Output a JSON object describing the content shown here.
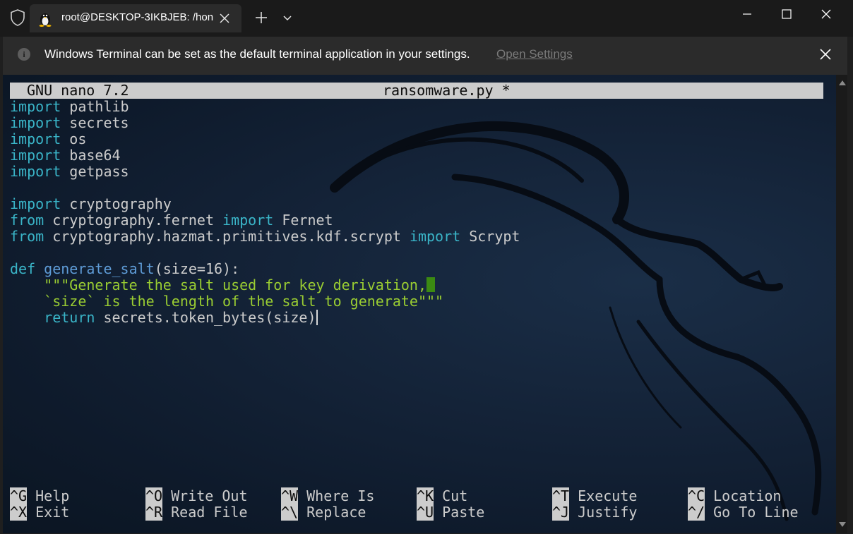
{
  "titlebar": {
    "tab_title": "root@DESKTOP-3IKBJEB: /hon",
    "icons": [
      "shield-icon",
      "linux-tux-icon",
      "close-icon",
      "plus-icon",
      "chevron-down-icon",
      "minimize-icon",
      "maximize-icon",
      "close-icon"
    ]
  },
  "infobar": {
    "message": "Windows Terminal can be set as the default terminal application in your settings.",
    "link": "Open Settings"
  },
  "nano": {
    "version": "GNU nano 7.2",
    "filename": "ransomware.py *"
  },
  "code_lines": [
    [
      {
        "t": "import",
        "c": "kw"
      },
      {
        "t": " pathlib",
        "c": ""
      }
    ],
    [
      {
        "t": "import",
        "c": "kw"
      },
      {
        "t": " secrets",
        "c": ""
      }
    ],
    [
      {
        "t": "import",
        "c": "kw"
      },
      {
        "t": " os",
        "c": ""
      }
    ],
    [
      {
        "t": "import",
        "c": "kw"
      },
      {
        "t": " base64",
        "c": ""
      }
    ],
    [
      {
        "t": "import",
        "c": "kw"
      },
      {
        "t": " getpass",
        "c": ""
      }
    ],
    [],
    [
      {
        "t": "import",
        "c": "kw"
      },
      {
        "t": " cryptography",
        "c": ""
      }
    ],
    [
      {
        "t": "from",
        "c": "kw"
      },
      {
        "t": " cryptography.fernet ",
        "c": ""
      },
      {
        "t": "import",
        "c": "kw"
      },
      {
        "t": " Fernet",
        "c": ""
      }
    ],
    [
      {
        "t": "from",
        "c": "kw"
      },
      {
        "t": " cryptography.hazmat.primitives.kdf.scrypt ",
        "c": ""
      },
      {
        "t": "import",
        "c": "kw"
      },
      {
        "t": " Scrypt",
        "c": ""
      }
    ],
    [],
    [
      {
        "t": "def",
        "c": "kw"
      },
      {
        "t": " ",
        "c": ""
      },
      {
        "t": "generate_salt",
        "c": "fn"
      },
      {
        "t": "(size=16):",
        "c": ""
      }
    ],
    [
      {
        "t": "    ",
        "c": ""
      },
      {
        "t": "\"\"\"Generate the salt used for key derivation,",
        "c": "doc"
      },
      {
        "t": "",
        "c": "cursor-block"
      }
    ],
    [
      {
        "t": "    ",
        "c": ""
      },
      {
        "t": "`size` is the length of the salt to generate\"\"\"",
        "c": "doc"
      }
    ],
    [
      {
        "t": "    ",
        "c": ""
      },
      {
        "t": "return",
        "c": "kw"
      },
      {
        "t": " secrets.token_bytes(size)",
        "c": ""
      },
      {
        "t": "",
        "c": "cursor-bar"
      }
    ]
  ],
  "shortcuts": [
    {
      "key": "^G",
      "label": "Help"
    },
    {
      "key": "^X",
      "label": "Exit"
    },
    {
      "key": "^O",
      "label": "Write Out"
    },
    {
      "key": "^R",
      "label": "Read File"
    },
    {
      "key": "^W",
      "label": "Where Is"
    },
    {
      "key": "^\\",
      "label": "Replace"
    },
    {
      "key": "^K",
      "label": "Cut"
    },
    {
      "key": "^U",
      "label": "Paste"
    },
    {
      "key": "^T",
      "label": "Execute"
    },
    {
      "key": "^J",
      "label": "Justify"
    },
    {
      "key": "^C",
      "label": "Location"
    },
    {
      "key": "^/",
      "label": "Go To Line"
    }
  ],
  "colors": {
    "keyword": "#3ab5c8",
    "function": "#5e9bd6",
    "docstring": "#9acd32",
    "text": "#cccccc",
    "cursor": "#3b8a12"
  }
}
